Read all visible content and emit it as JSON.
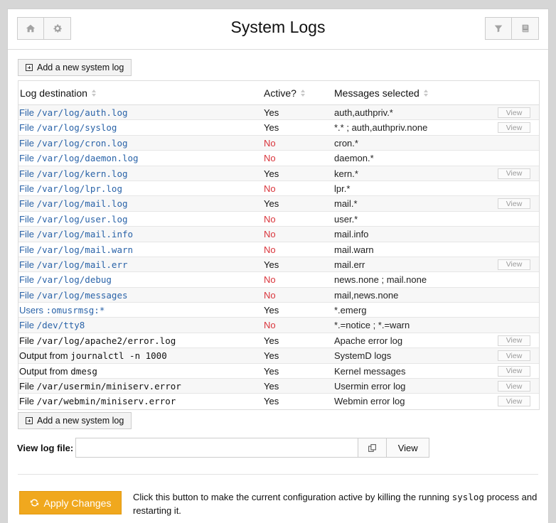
{
  "header": {
    "title": "System Logs",
    "left_icons": [
      "home-icon",
      "gear-icon"
    ],
    "right_icons": [
      "filter-icon",
      "book-icon"
    ]
  },
  "add_button_label": "Add a new system log",
  "table": {
    "columns": [
      "Log destination",
      "Active?",
      "Messages selected"
    ],
    "view_label": "View",
    "rows": [
      {
        "type": "File",
        "path": "/var/log/auth.log",
        "link": true,
        "active": "Yes",
        "messages": "auth,authpriv.*",
        "view": true
      },
      {
        "type": "File",
        "path": "/var/log/syslog",
        "link": true,
        "active": "Yes",
        "messages": "*.* ; auth,authpriv.none",
        "view": true
      },
      {
        "type": "File",
        "path": "/var/log/cron.log",
        "link": true,
        "active": "No",
        "messages": "cron.*",
        "view": false
      },
      {
        "type": "File",
        "path": "/var/log/daemon.log",
        "link": true,
        "active": "No",
        "messages": "daemon.*",
        "view": false
      },
      {
        "type": "File",
        "path": "/var/log/kern.log",
        "link": true,
        "active": "Yes",
        "messages": "kern.*",
        "view": true
      },
      {
        "type": "File",
        "path": "/var/log/lpr.log",
        "link": true,
        "active": "No",
        "messages": "lpr.*",
        "view": false
      },
      {
        "type": "File",
        "path": "/var/log/mail.log",
        "link": true,
        "active": "Yes",
        "messages": "mail.*",
        "view": true
      },
      {
        "type": "File",
        "path": "/var/log/user.log",
        "link": true,
        "active": "No",
        "messages": "user.*",
        "view": false
      },
      {
        "type": "File",
        "path": "/var/log/mail.info",
        "link": true,
        "active": "No",
        "messages": "mail.info",
        "view": false
      },
      {
        "type": "File",
        "path": "/var/log/mail.warn",
        "link": true,
        "active": "No",
        "messages": "mail.warn",
        "view": false
      },
      {
        "type": "File",
        "path": "/var/log/mail.err",
        "link": true,
        "active": "Yes",
        "messages": "mail.err",
        "view": true
      },
      {
        "type": "File",
        "path": "/var/log/debug",
        "link": true,
        "active": "No",
        "messages": "news.none ; mail.none",
        "view": false
      },
      {
        "type": "File",
        "path": "/var/log/messages",
        "link": true,
        "active": "No",
        "messages": "mail,news.none",
        "view": false
      },
      {
        "type": "Users",
        "path": ":omusrmsg:*",
        "link": true,
        "active": "Yes",
        "messages": "*.emerg",
        "view": false
      },
      {
        "type": "File",
        "path": "/dev/tty8",
        "link": true,
        "active": "No",
        "messages": "*.=notice ; *.=warn",
        "view": false
      },
      {
        "type": "File",
        "path": "/var/log/apache2/error.log",
        "link": false,
        "active": "Yes",
        "messages": "Apache error log",
        "view": true
      },
      {
        "type": "Output from",
        "path": "journalctl -n 1000",
        "link": false,
        "active": "Yes",
        "messages": "SystemD logs",
        "view": true
      },
      {
        "type": "Output from",
        "path": "dmesg",
        "link": false,
        "active": "Yes",
        "messages": "Kernel messages",
        "view": true
      },
      {
        "type": "File",
        "path": "/var/usermin/miniserv.error",
        "link": false,
        "active": "Yes",
        "messages": "Usermin error log",
        "view": true
      },
      {
        "type": "File",
        "path": "/var/webmin/miniserv.error",
        "link": false,
        "active": "Yes",
        "messages": "Webmin error log",
        "view": true
      }
    ]
  },
  "view_log": {
    "label": "View log file:",
    "value": "",
    "button_label": "View"
  },
  "apply": {
    "button_label": "Apply Changes",
    "desc_before": "Click this button to make the current configuration active by killing the running ",
    "desc_code": "syslog",
    "desc_after": " process and restarting it."
  },
  "colors": {
    "link": "#2a63a8",
    "inactive": "#d9343b",
    "apply_button": "#f0a81e"
  }
}
